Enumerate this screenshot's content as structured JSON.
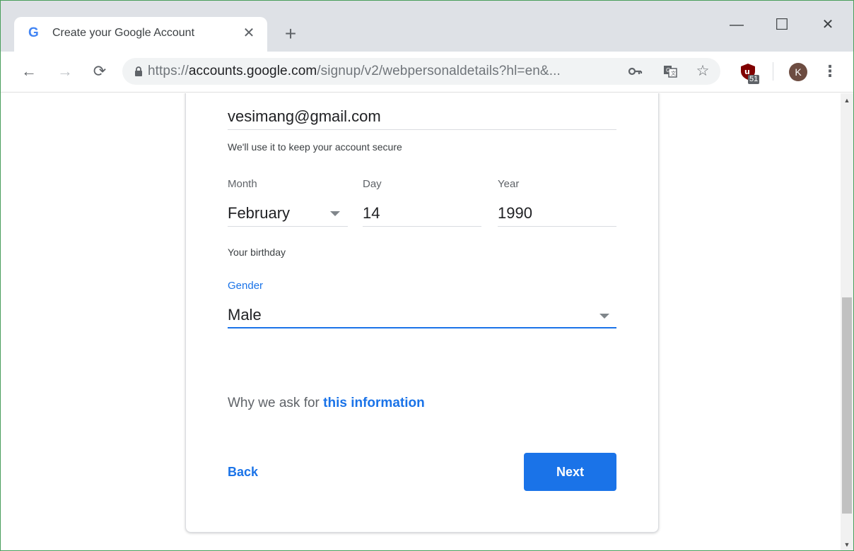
{
  "browser": {
    "tab": {
      "favicon": "G",
      "title": "Create your Google Account",
      "close": "✕"
    },
    "new_tab": "+",
    "window_controls": {
      "minimize": "—",
      "maximize": "☐",
      "close": "✕"
    },
    "nav": {
      "back": "←",
      "forward": "→",
      "reload": "⟳"
    },
    "url": {
      "scheme": "https://",
      "host": "accounts.google.com",
      "path": "/signup/v2/webpersonaldetails?hl=en&..."
    },
    "omnibox_icons": [
      "key-icon",
      "translate-icon",
      "star-icon"
    ],
    "extension_badge": "51",
    "profile_initial": "K",
    "menu": "⋮"
  },
  "form": {
    "recovery_email": {
      "value": "vesimang@gmail.com",
      "helper": "We'll use it to keep your account secure"
    },
    "birthday": {
      "month_label": "Month",
      "month_value": "February",
      "day_label": "Day",
      "day_value": "14",
      "year_label": "Year",
      "year_value": "1990",
      "helper": "Your birthday"
    },
    "gender": {
      "label": "Gender",
      "value": "Male"
    },
    "why": {
      "prefix": "Why we ask for ",
      "link": "this information"
    },
    "back_label": "Back",
    "next_label": "Next"
  },
  "colors": {
    "accent": "#1a73e8",
    "window_border": "#4a9e5c",
    "tabstrip": "#dee1e6"
  }
}
